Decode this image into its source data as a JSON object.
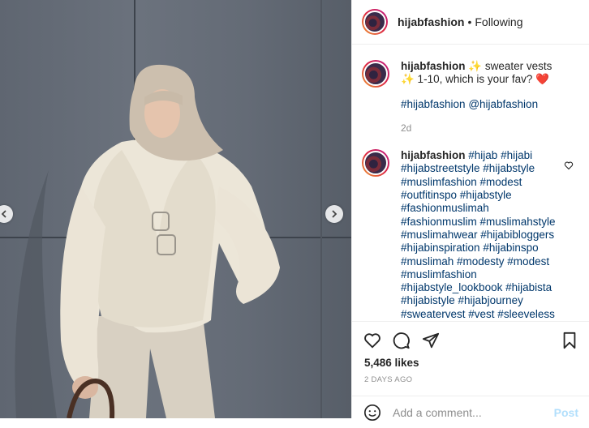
{
  "post": {
    "username": "hijabfashion",
    "follow_status": "Following",
    "separator": "•"
  },
  "caption": {
    "username": "hijabfashion",
    "text": "✨ sweater vests ✨ 1-10, which is your fav? ❤️",
    "tags": "#hijabfashion @hijabfashion",
    "time": "2d"
  },
  "comment": {
    "username": "hijabfashion",
    "tags": "#hijab #hijabi #hijabstreetstyle #hijabstyle #muslimfashion #modest #outfitinspo #hijabstyle #fashionmuslimah #fashionmuslim #muslimahstyle #muslimahwear #hijabibloggers #hijabinspiration #hijabinspo #muslimah #modesty #modest #muslimfashion #hijabstyle_lookbook #hijabista #hijabistyle #hijabjourney #sweatervest #vest #sleeveless"
  },
  "likes": "5,486 likes",
  "time_ago": "2 DAYS AGO",
  "add_comment": {
    "placeholder": "Add a comment...",
    "post_label": "Post"
  },
  "icons": {
    "like": "heart-icon",
    "comment": "comment-icon",
    "share": "share-icon",
    "save": "bookmark-icon",
    "emoji": "emoji-icon",
    "prev": "chevron-left-icon",
    "next": "chevron-right-icon"
  },
  "colors": {
    "post_button": "#b2dffc",
    "hashtag": "#00376b",
    "secondary_text": "#8e8e8e"
  }
}
